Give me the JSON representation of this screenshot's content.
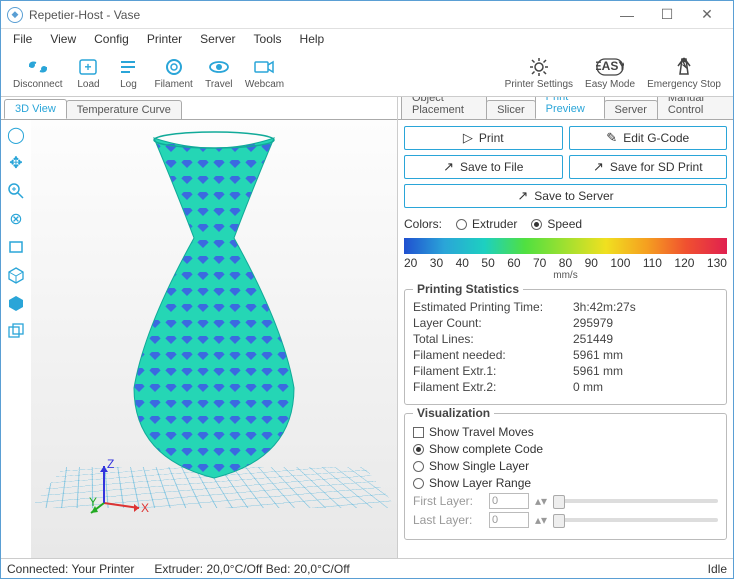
{
  "window": {
    "title": "Repetier-Host - Vase"
  },
  "menu": [
    "File",
    "View",
    "Config",
    "Printer",
    "Server",
    "Tools",
    "Help"
  ],
  "toolbar_left": [
    {
      "id": "disconnect",
      "label": "Disconnect"
    },
    {
      "id": "load",
      "label": "Load"
    },
    {
      "id": "log",
      "label": "Log"
    },
    {
      "id": "filament",
      "label": "Filament"
    },
    {
      "id": "travel",
      "label": "Travel"
    },
    {
      "id": "webcam",
      "label": "Webcam"
    }
  ],
  "toolbar_right": [
    {
      "id": "printer-settings",
      "label": "Printer Settings"
    },
    {
      "id": "easy-mode",
      "label": "Easy Mode"
    },
    {
      "id": "emergency-stop",
      "label": "Emergency Stop"
    }
  ],
  "left_tabs": [
    "3D View",
    "Temperature Curve"
  ],
  "right_tabs": [
    "Object Placement",
    "Slicer",
    "Print Preview",
    "Server",
    "Manual Control"
  ],
  "right_active_tab": 2,
  "buttons": {
    "print": "Print",
    "edit_gcode": "Edit G-Code",
    "save_file": "Save to File",
    "save_sd": "Save for SD Print",
    "save_server": "Save to Server"
  },
  "colors": {
    "label": "Colors:",
    "opt_extruder": "Extruder",
    "opt_speed": "Speed",
    "selected": "speed",
    "ticks": [
      "20",
      "30",
      "40",
      "50",
      "60",
      "70",
      "80",
      "90",
      "100",
      "110",
      "120",
      "130"
    ],
    "unit": "mm/s"
  },
  "stats": {
    "title": "Printing Statistics",
    "rows": [
      {
        "k": "Estimated Printing Time:",
        "v": "3h:42m:27s"
      },
      {
        "k": "Layer Count:",
        "v": "295979"
      },
      {
        "k": "Total Lines:",
        "v": "251449"
      },
      {
        "k": "Filament needed:",
        "v": "5961 mm"
      },
      {
        "k": "Filament Extr.1:",
        "v": "5961 mm"
      },
      {
        "k": "Filament Extr.2:",
        "v": "0 mm"
      }
    ]
  },
  "viz": {
    "title": "Visualization",
    "show_travel": "Show Travel Moves",
    "show_complete": "Show complete Code",
    "show_single": "Show Single Layer",
    "show_range": "Show Layer Range",
    "first": "First Layer:",
    "last": "Last Layer:",
    "first_val": "0",
    "last_val": "0"
  },
  "status": {
    "conn": "Connected: Your Printer",
    "extruder": "Extruder: 20,0°C/Off Bed: 20,0°C/Off",
    "idle": "Idle"
  },
  "axes": {
    "x": "X",
    "y": "Y",
    "z": "Z"
  }
}
